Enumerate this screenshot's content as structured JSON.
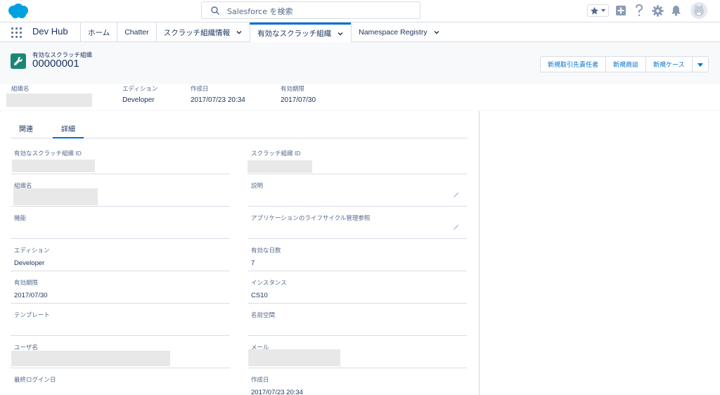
{
  "header": {
    "search_placeholder": "Salesforce を検索",
    "icons": [
      "salesforce-cloud-logo",
      "search-icon",
      "favorites-star-icon",
      "chevron-down-icon",
      "global-create-icon",
      "help-icon",
      "setup-gear-icon",
      "notification-bell-icon",
      "user-avatar-icon"
    ]
  },
  "nav": {
    "app_name": "Dev Hub",
    "items": [
      {
        "label": "ホーム"
      },
      {
        "label": "Chatter"
      },
      {
        "label": "スクラッチ組織情報"
      },
      {
        "label": "有効なスクラッチ組織"
      },
      {
        "label": "Namespace Registry"
      }
    ]
  },
  "record": {
    "object_label": "有効なスクラッチ組織",
    "name": "00000001",
    "actions": [
      "新規取引先責任者",
      "新規商談",
      "新規ケース"
    ]
  },
  "highlights": [
    {
      "label": "組織名",
      "value": ""
    },
    {
      "label": "エディション",
      "value": "Developer"
    },
    {
      "label": "作成日",
      "value": "2017/07/23 20:34"
    },
    {
      "label": "有効期限",
      "value": "2017/07/30"
    }
  ],
  "tabs": [
    "関連",
    "詳細"
  ],
  "details": [
    {
      "left": {
        "label": "有効なスクラッチ組織 ID",
        "value": ""
      },
      "right": {
        "label": "スクラッチ組織 ID",
        "value": ""
      }
    },
    {
      "left": {
        "label": "組織名",
        "value": ""
      },
      "right": {
        "label": "説明",
        "value": ""
      }
    },
    {
      "left": {
        "label": "機能",
        "value": ""
      },
      "right": {
        "label": "アプリケーションのライフサイクル管理参照",
        "value": ""
      }
    },
    {
      "left": {
        "label": "エディション",
        "value": "Developer"
      },
      "right": {
        "label": "有効な日数",
        "value": "7"
      }
    },
    {
      "left": {
        "label": "有効期限",
        "value": "2017/07/30"
      },
      "right": {
        "label": "インスタンス",
        "value": "CS10"
      }
    },
    {
      "left": {
        "label": "テンプレート",
        "value": ""
      },
      "right": {
        "label": "名前空間",
        "value": ""
      }
    },
    {
      "left": {
        "label": "ユーザ名",
        "value": ""
      },
      "right": {
        "label": "メール",
        "value": ""
      }
    },
    {
      "left": {
        "label": "最終ログイン日",
        "value": ""
      },
      "right": {
        "label": "作成日",
        "value": "2017/07/23 20:34"
      }
    }
  ],
  "colors": {
    "brand": "#0070d2",
    "record_icon": "#1a8774",
    "text": "#16325c",
    "label": "#54698d",
    "border": "#d8dde6"
  }
}
